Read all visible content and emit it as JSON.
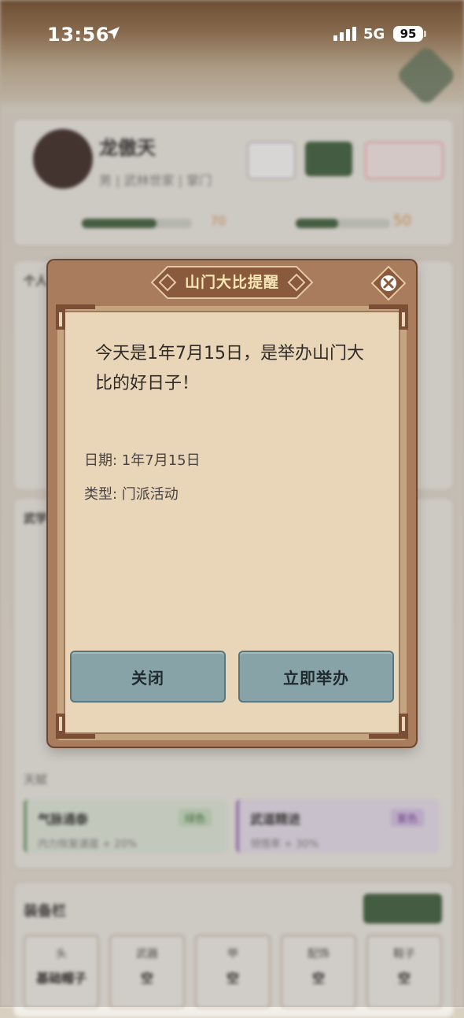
{
  "status_bar": {
    "time": "13:56",
    "network": "5G",
    "battery": "95"
  },
  "background": {
    "hero_name": "龙傲天",
    "hero_meta": "男 | 武林世家 | 掌门",
    "stat_values": [
      "70",
      "50"
    ],
    "sections": [
      "个人",
      "武学",
      "天赋"
    ],
    "talents": [
      {
        "name": "气脉通泰",
        "tag": "绿色",
        "desc": "内力恢复速度 + 20%"
      },
      {
        "name": "武道精进",
        "tag": "紫色",
        "desc": "领悟率 + 30%"
      }
    ],
    "equipment_title": "装备栏",
    "equipment_slots": [
      {
        "type": "头",
        "item": "基础帽子"
      },
      {
        "type": "武器",
        "item": "空"
      },
      {
        "type": "甲",
        "item": "空"
      },
      {
        "type": "配饰",
        "item": "空"
      },
      {
        "type": "鞋子",
        "item": "空"
      }
    ]
  },
  "modal": {
    "title": "山门大比提醒",
    "message": "今天是1年7月15日，是举办山门大比的好日子！",
    "date_line": "日期: 1年7月15日",
    "type_line": "类型: 门派活动",
    "close_label": "关闭",
    "confirm_label": "立即举办",
    "colors": {
      "frame": "#a87c5d",
      "paper": "#e9d6b8",
      "button": "#88a3a8",
      "title_text": "#f7e7b5"
    }
  }
}
